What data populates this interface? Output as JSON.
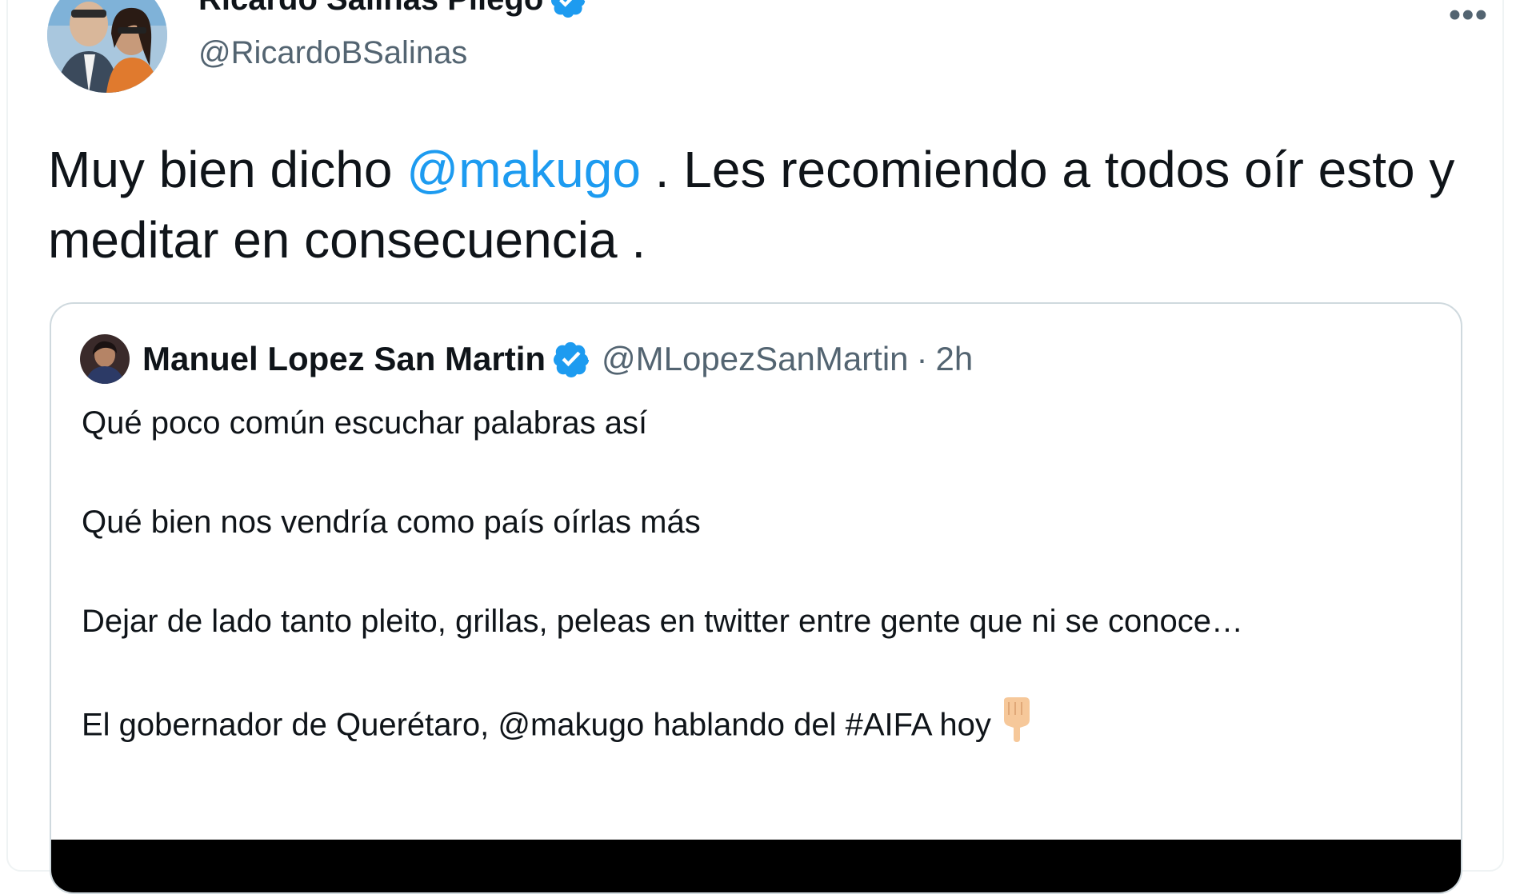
{
  "author": {
    "name": "Ricardo Salinas Pliego",
    "handle": "@RicardoBSalinas",
    "verified": true
  },
  "more_icon": "more-options-icon",
  "tweet": {
    "text_before": "Muy bien dicho ",
    "mention": "@makugo",
    "text_after": " . Les recomiendo a todos oír esto y meditar en consecuencia ."
  },
  "quoted_tweet": {
    "author_name": "Manuel Lopez San Martin",
    "handle": "@MLopezSanMartin",
    "separator": "·",
    "time": "2h",
    "verified": true,
    "lines": [
      "Qué poco común escuchar palabras así",
      "Qué bien nos vendría como país oírlas más",
      "Dejar de lado tanto pleito, grillas, peleas en twitter entre gente que ni se conoce…",
      "El gobernador de Querétaro, @makugo hablando del #AIFA hoy"
    ],
    "emoji_icon": "pointing-down-hand-icon"
  },
  "colors": {
    "link": "#1d9bf0",
    "text": "#0f1419",
    "secondary": "#536471",
    "border": "#cfd9de",
    "verified": "#1d9bf0"
  }
}
